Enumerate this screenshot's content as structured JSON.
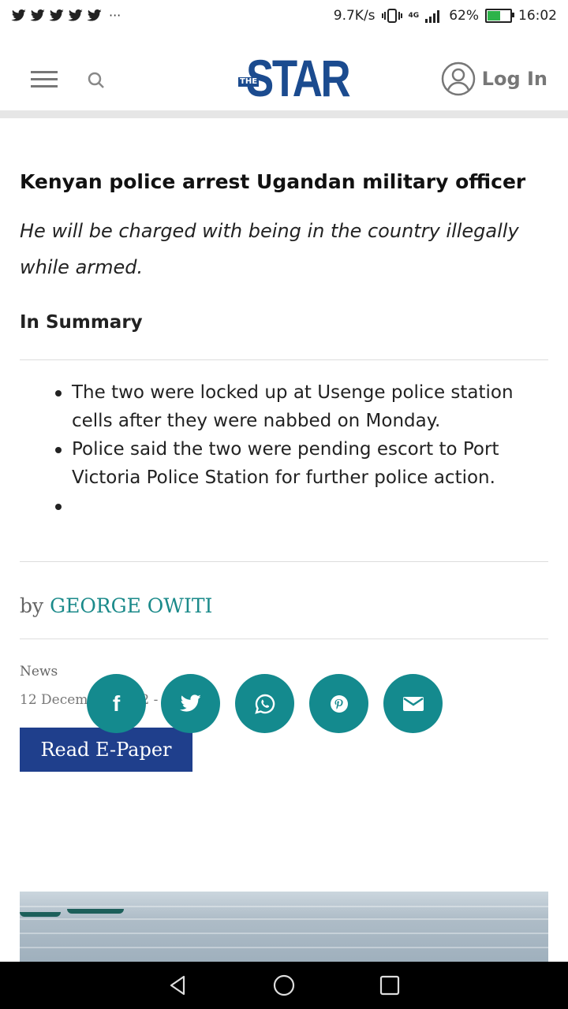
{
  "status_bar": {
    "net_speed": "9.7K/s",
    "network": "4G",
    "battery": "62%",
    "battery_level": 0.62,
    "time": "16:02"
  },
  "header": {
    "logo_small": "THE",
    "logo_big": "STAR",
    "login_label": "Log In"
  },
  "article": {
    "title": "Kenyan police arrest Ugandan military officer",
    "subtitle": "He will be charged with being in the country illegally while armed.",
    "summary_label": "In Summary",
    "summary_items": [
      "The two were locked up at Usenge police station cells after they were nabbed on Monday.",
      "Police said the two were pending escort to Port Victoria Police Station for further police action.",
      ""
    ],
    "byline_prefix": "by",
    "author": "GEORGE OWITI",
    "category": "News",
    "date": "12 December 2022 - 15:31",
    "epaper_label": "Read E-Paper"
  },
  "share": {
    "facebook_glyph": "f",
    "icons": [
      "facebook-icon",
      "twitter-icon",
      "whatsapp-icon",
      "pinterest-icon",
      "mail-icon"
    ]
  },
  "colors": {
    "brand_blue": "#1b4b8f",
    "teal": "#148a8e",
    "epaper_bg": "#1f3f8c"
  }
}
